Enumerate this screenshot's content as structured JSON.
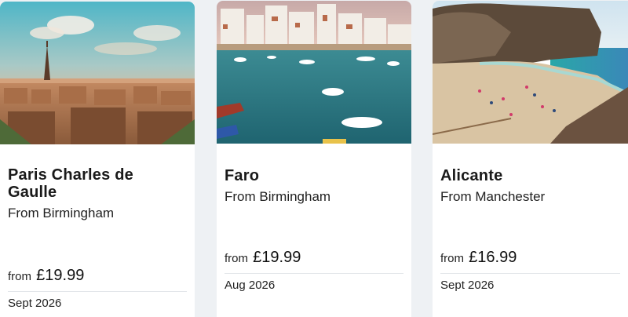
{
  "cards": [
    {
      "title": "Paris Charles de Gaulle",
      "origin": "From Birmingham",
      "price_prefix": "from",
      "price": "£19.99",
      "date": "Sept 2026",
      "photo_icon": "paris-eiffel-tower-photo"
    },
    {
      "title": "Faro",
      "origin": "From Birmingham",
      "price_prefix": "from",
      "price": "£19.99",
      "date": "Aug 2026",
      "photo_icon": "faro-harbour-photo"
    },
    {
      "title": "Alicante",
      "origin": "From Manchester",
      "price_prefix": "from",
      "price": "£16.99",
      "date": "Sept 2026",
      "photo_icon": "alicante-beach-photo"
    }
  ]
}
